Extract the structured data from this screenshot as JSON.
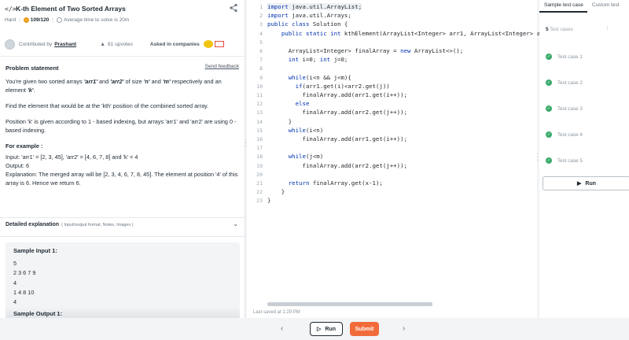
{
  "problem": {
    "title": "K-th Element of Two Sorted Arrays",
    "difficulty": "Hard",
    "score": "109/120",
    "avg_time": "Average time to solve is 20m",
    "contributed_by_label": "Contributed by",
    "contributor": "Prashant",
    "upvotes": "81 upvotes",
    "asked_in_label": "Asked in companies"
  },
  "statement": {
    "heading": "Problem statement",
    "feedback_link": "Send feedback",
    "p1_a": "You're given two sorted arrays ",
    "arr1": "'arr1'",
    "p1_b": " and ",
    "arr2": "'arr2'",
    "p1_c": " of size ",
    "n": "'n'",
    "p1_d": " and ",
    "m": "'m'",
    "p1_e": " respectively and an element ",
    "k": "'k'",
    "p1_f": ".",
    "p2": "Find the element that would be at the 'kth' position of the combined sorted array.",
    "p3": "Position 'k' is given according to 1 - based indexing, but arrays 'arr1' and 'arr2' are using 0 - based indexing.",
    "example_heading": "For example :",
    "ex_input": "Input: 'arr1' = [2, 3, 45], 'arr2' = [4, 6, 7, 8] and 'k' = 4",
    "ex_output": "Output: 6",
    "ex_explanation": "Explanation: The merged array will be [2, 3, 4, 6, 7, 8, 45]. The element at position '4' of this array is 6. Hence we return 6."
  },
  "detailed": {
    "title": "Detailed explanation",
    "subtitle": "( Input/output format, Notes, Images )"
  },
  "sample": {
    "input_label": "Sample Input 1:",
    "input_lines": [
      "5",
      "2 3 6 7 9",
      "4",
      "1 4 8 10",
      "4"
    ],
    "output_label": "Sample Output 1:"
  },
  "editor": {
    "lines": [
      "import java.util.ArrayList;",
      "import java.util.Arrays;",
      "public class Solution {",
      "    public static int kthElement(ArrayList<Integer> arr1, ArrayList<Integer> arr2, int n, int m, int k) {",
      "",
      "      ArrayList<Integer> finalArray = new ArrayList<>();",
      "      int i=0; int j=0;",
      "",
      "      while(i<n && j<m){",
      "        if(arr1.get(i)<arr2.get(j))",
      "          finalArray.add(arr1.get(i++));",
      "        else",
      "          finalArray.add(arr2.get(j++));",
      "      }",
      "      while(i<n)",
      "          finalArray.add(arr1.get(i++));",
      "",
      "      while(j<m)",
      "          finalArray.add(arr2.get(j++));",
      "",
      "      return finalArray.get(x-1);",
      "    }",
      "}"
    ],
    "last_saved": "Last saved at 1:29 PM"
  },
  "tests": {
    "tab_sample": "Sample test case",
    "tab_custom": "Custom test",
    "count_num": "5",
    "count_label": "Test cases",
    "cases": [
      "Test case 1",
      "Test case 2",
      "Test case 3",
      "Test case 4",
      "Test case 5"
    ],
    "run_label": "Run"
  },
  "bottom": {
    "run_label": "Run",
    "submit_label": "Submit",
    "prev": "‹",
    "next": "›"
  },
  "colors": {
    "accent_submit": "#f26b3a",
    "check_green": "#3cab6d",
    "keyword_blue": "#0033b3"
  }
}
